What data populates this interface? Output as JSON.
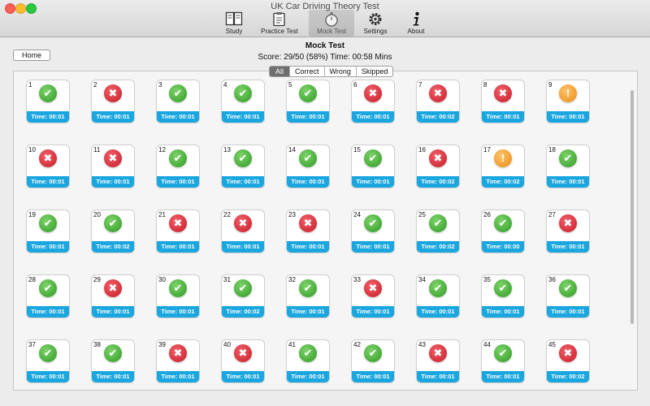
{
  "window": {
    "title": "UK Car Driving Theory Test"
  },
  "toolbar": {
    "items": [
      {
        "label": "Study",
        "icon": "book-icon",
        "selected": false
      },
      {
        "label": "Practice Test",
        "icon": "clipboard-icon",
        "selected": false
      },
      {
        "label": "Mock Test",
        "icon": "stopwatch-icon",
        "selected": true
      },
      {
        "label": "Settings",
        "icon": "gear-icon",
        "selected": false
      },
      {
        "label": "About",
        "icon": "info-icon",
        "selected": false
      }
    ]
  },
  "home_label": "Home",
  "page_title": "Mock Test",
  "score_line": "Score: 29/50 (58%) Time: 00:58 Mins",
  "filters": [
    {
      "label": "All",
      "active": true
    },
    {
      "label": "Correct",
      "active": false
    },
    {
      "label": "Wrong",
      "active": false
    },
    {
      "label": "Skipped",
      "active": false
    }
  ],
  "status_colors": {
    "correct": "#2d9a23",
    "wrong": "#c51b27",
    "skipped": "#e88a12",
    "time_bar": "#1aa6de"
  },
  "questions": [
    {
      "number": "1",
      "status": "correct",
      "time": "Time: 00:01"
    },
    {
      "number": "2",
      "status": "wrong",
      "time": "Time: 00:01"
    },
    {
      "number": "3",
      "status": "correct",
      "time": "Time: 00:01"
    },
    {
      "number": "4",
      "status": "correct",
      "time": "Time: 00:01"
    },
    {
      "number": "5",
      "status": "correct",
      "time": "Time: 00:01"
    },
    {
      "number": "6",
      "status": "wrong",
      "time": "Time: 00:01"
    },
    {
      "number": "7",
      "status": "wrong",
      "time": "Time: 00:02"
    },
    {
      "number": "8",
      "status": "wrong",
      "time": "Time: 00:01"
    },
    {
      "number": "9",
      "status": "skipped",
      "time": "Time: 00:01"
    },
    {
      "number": "10",
      "status": "wrong",
      "time": "Time: 00:01"
    },
    {
      "number": "11",
      "status": "wrong",
      "time": "Time: 00:01"
    },
    {
      "number": "12",
      "status": "correct",
      "time": "Time: 00:01"
    },
    {
      "number": "13",
      "status": "correct",
      "time": "Time: 00:01"
    },
    {
      "number": "14",
      "status": "correct",
      "time": "Time: 00:01"
    },
    {
      "number": "15",
      "status": "correct",
      "time": "Time: 00:01"
    },
    {
      "number": "16",
      "status": "wrong",
      "time": "Time: 00:02"
    },
    {
      "number": "17",
      "status": "skipped",
      "time": "Time: 00:02"
    },
    {
      "number": "18",
      "status": "correct",
      "time": "Time: 00:01"
    },
    {
      "number": "19",
      "status": "correct",
      "time": "Time: 00:01"
    },
    {
      "number": "20",
      "status": "correct",
      "time": "Time: 00:02"
    },
    {
      "number": "21",
      "status": "wrong",
      "time": "Time: 00:01"
    },
    {
      "number": "22",
      "status": "wrong",
      "time": "Time: 00:01"
    },
    {
      "number": "23",
      "status": "wrong",
      "time": "Time: 00:01"
    },
    {
      "number": "24",
      "status": "correct",
      "time": "Time: 00:01"
    },
    {
      "number": "25",
      "status": "correct",
      "time": "Time: 00:02"
    },
    {
      "number": "26",
      "status": "correct",
      "time": "Time: 00:00"
    },
    {
      "number": "27",
      "status": "wrong",
      "time": "Time: 00:01"
    },
    {
      "number": "28",
      "status": "correct",
      "time": "Time: 00:01"
    },
    {
      "number": "29",
      "status": "wrong",
      "time": "Time: 00:01"
    },
    {
      "number": "30",
      "status": "correct",
      "time": "Time: 00:01"
    },
    {
      "number": "31",
      "status": "correct",
      "time": "Time: 00:02"
    },
    {
      "number": "32",
      "status": "correct",
      "time": "Time: 00:01"
    },
    {
      "number": "33",
      "status": "wrong",
      "time": "Time: 00:01"
    },
    {
      "number": "34",
      "status": "correct",
      "time": "Time: 00:01"
    },
    {
      "number": "35",
      "status": "correct",
      "time": "Time: 00:01"
    },
    {
      "number": "36",
      "status": "correct",
      "time": "Time: 00:01"
    },
    {
      "number": "37",
      "status": "correct",
      "time": "Time: 00:01"
    },
    {
      "number": "38",
      "status": "correct",
      "time": "Time: 00:01"
    },
    {
      "number": "39",
      "status": "wrong",
      "time": "Time: 00:01"
    },
    {
      "number": "40",
      "status": "wrong",
      "time": "Time: 00:01"
    },
    {
      "number": "41",
      "status": "correct",
      "time": "Time: 00:01"
    },
    {
      "number": "42",
      "status": "correct",
      "time": "Time: 00:01"
    },
    {
      "number": "43",
      "status": "wrong",
      "time": "Time: 00:01"
    },
    {
      "number": "44",
      "status": "correct",
      "time": "Time: 00:01"
    },
    {
      "number": "45",
      "status": "wrong",
      "time": "Time: 00:02"
    }
  ]
}
